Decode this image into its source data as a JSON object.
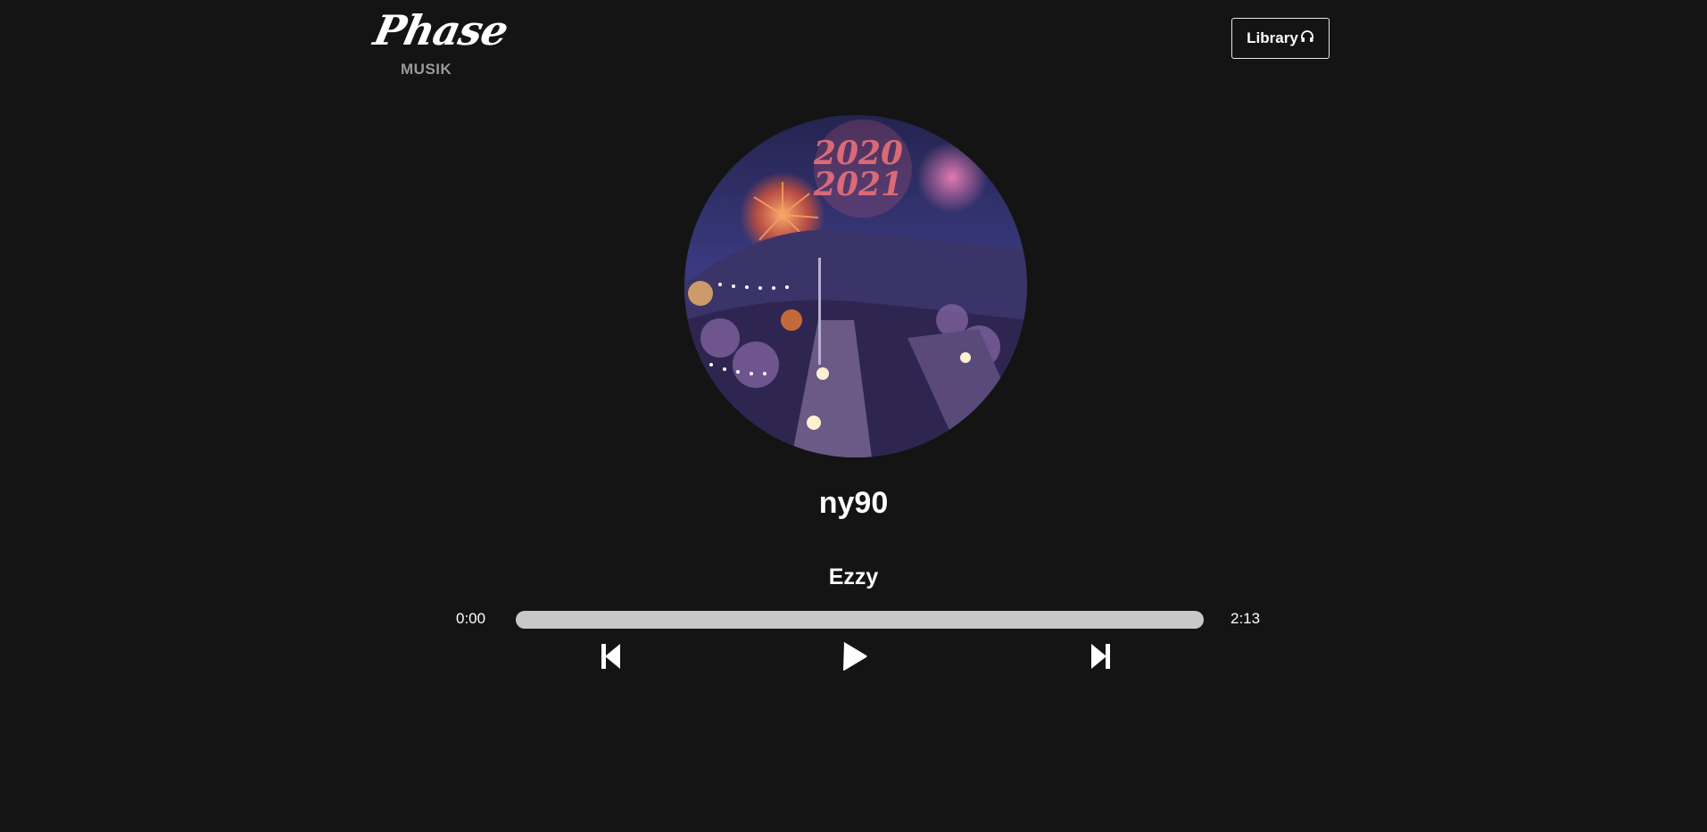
{
  "header": {
    "logo_text": "Phase",
    "logo_subtitle": "MUSIK",
    "library_label": "Library",
    "library_icon": "headphones-icon"
  },
  "player": {
    "cover_art_icon": "album-cover",
    "title": "ny90",
    "artist": "Ezzy",
    "current_time": "0:00",
    "total_time": "2:13",
    "progress": 0
  },
  "controls": {
    "prev_icon": "skip-back-icon",
    "play_icon": "play-icon",
    "next_icon": "skip-forward-icon"
  },
  "colors": {
    "background": "#141414",
    "text": "#ffffff",
    "muted": "#9a9a9a",
    "progress_track": "#c8c8c8"
  }
}
